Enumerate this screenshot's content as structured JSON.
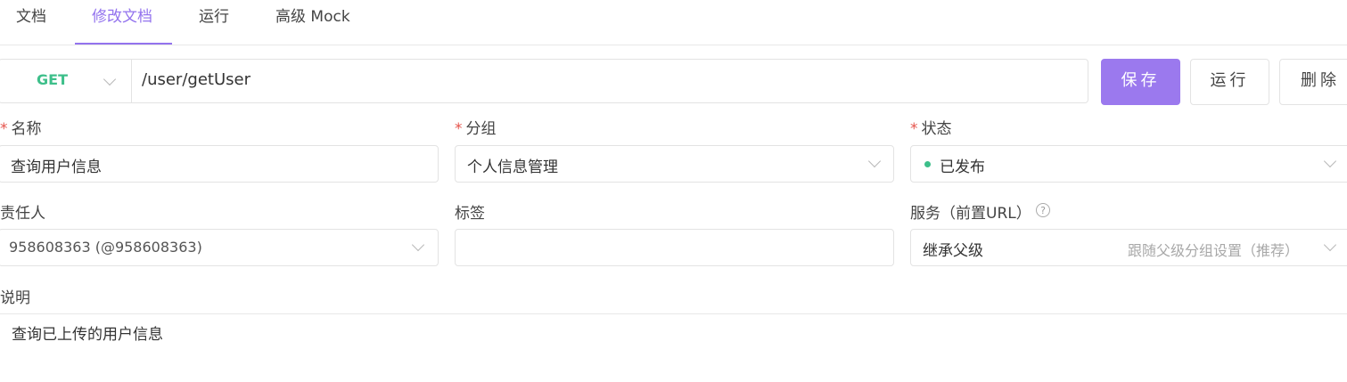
{
  "tabs": [
    {
      "label": "文档"
    },
    {
      "label": "修改文档"
    },
    {
      "label": "运行"
    },
    {
      "label": "高级 Mock"
    }
  ],
  "request": {
    "method": "GET",
    "path": "/user/getUser"
  },
  "buttons": {
    "save": "保存",
    "run": "运行",
    "delete": "删除"
  },
  "form": {
    "name": {
      "label": "名称",
      "required_mark": "*",
      "value": "查询用户信息"
    },
    "group": {
      "label": "分组",
      "required_mark": "*",
      "value": "个人信息管理"
    },
    "status": {
      "label": "状态",
      "required_mark": "*",
      "value": "已发布"
    },
    "owner": {
      "label": "责任人",
      "value": "958608363 (@958608363)"
    },
    "tags": {
      "label": "标签",
      "value": ""
    },
    "service": {
      "label": "服务（前置URL）",
      "value": "继承父级",
      "hint": "跟随父级分组设置（推荐）"
    },
    "description": {
      "label": "说明",
      "value": "查询已上传的用户信息"
    }
  },
  "icons": {
    "help": "question-circle-icon",
    "dropdown": "chevron-down-icon"
  },
  "colors": {
    "accent": "#9373ee",
    "primary_button": "#9b79ee",
    "method_get": "#3dbf8a",
    "status_dot": "#3dbf8a",
    "required": "#e5534b"
  }
}
